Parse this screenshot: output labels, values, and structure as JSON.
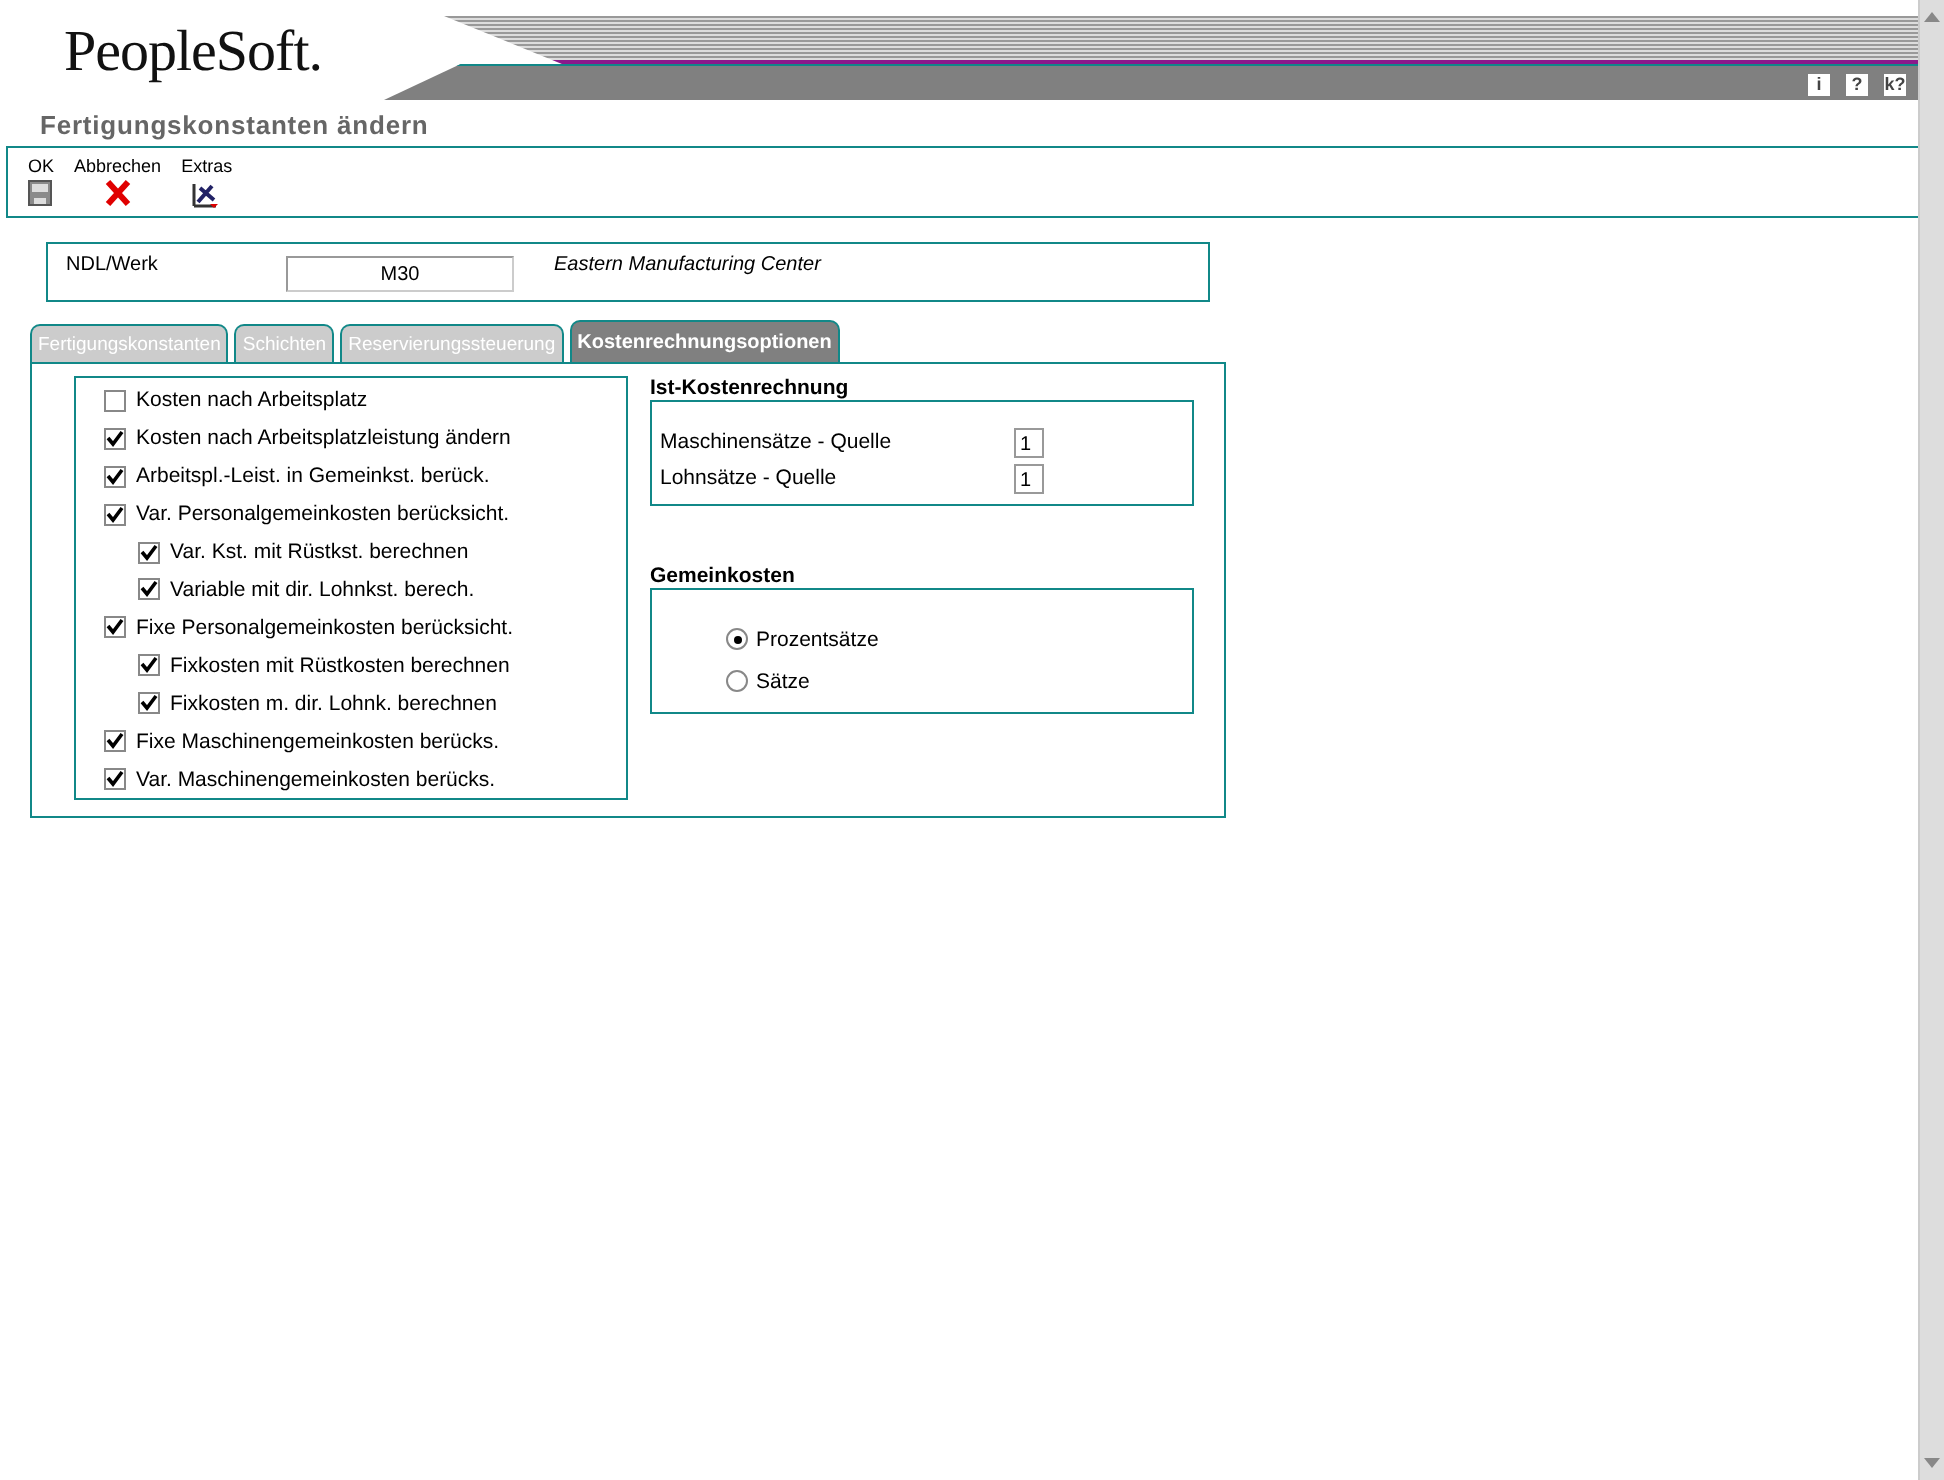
{
  "logo": "PeopleSoft.",
  "header_icons": [
    {
      "label": "i"
    },
    {
      "label": "?"
    },
    {
      "label": "k?"
    }
  ],
  "page_title": "Fertigungskonstanten ändern",
  "toolbar": [
    {
      "label": "OK",
      "kind": "save"
    },
    {
      "label": "Abbrechen",
      "kind": "cancel"
    },
    {
      "label": "Extras",
      "kind": "tools"
    }
  ],
  "header_form": {
    "label": "NDL/Werk",
    "value": "M30",
    "description": "Eastern Manufacturing Center"
  },
  "tabs": [
    {
      "label": "Fertigungskonstanten",
      "selected": false
    },
    {
      "label": "Schichten",
      "selected": false
    },
    {
      "label": "Reservierungssteuerung",
      "selected": false
    },
    {
      "label": "Kostenrechnungsoptionen",
      "selected": true
    }
  ],
  "options": [
    {
      "label": "Kosten nach Arbeitsplatz",
      "checked": false
    },
    {
      "label": "Kosten nach Arbeitsplatzleistung ändern",
      "checked": true
    },
    {
      "label": "Arbeitspl.-Leist. in Gemeinkst. berück.",
      "checked": true
    },
    {
      "label": "Var. Personalgemeinkosten berücksicht.",
      "checked": true,
      "children": [
        {
          "label": "Var. Kst. mit Rüstkst. berechnen",
          "checked": true
        },
        {
          "label": "Variable mit dir. Lohnkst. berech.",
          "checked": true
        }
      ]
    },
    {
      "label": "Fixe Personalgemeinkosten berücksicht.",
      "checked": true,
      "children": [
        {
          "label": "Fixkosten mit Rüstkosten berechnen",
          "checked": true
        },
        {
          "label": "Fixkosten m. dir. Lohnk. berechnen",
          "checked": true
        }
      ]
    },
    {
      "label": "Fixe Maschinengemeinkosten berücks.",
      "checked": true
    },
    {
      "label": "Var. Maschinengemeinkosten berücks.",
      "checked": true
    }
  ],
  "actual_costing": {
    "title": "Ist-Kostenrechnung",
    "fields": [
      {
        "label": "Maschinensätze - Quelle",
        "value": "1"
      },
      {
        "label": "Lohnsätze - Quelle",
        "value": "1"
      }
    ]
  },
  "overhead": {
    "title": "Gemeinkosten",
    "choices": [
      {
        "label": "Prozentsätze",
        "selected": true
      },
      {
        "label": "Sätze",
        "selected": false
      }
    ]
  }
}
